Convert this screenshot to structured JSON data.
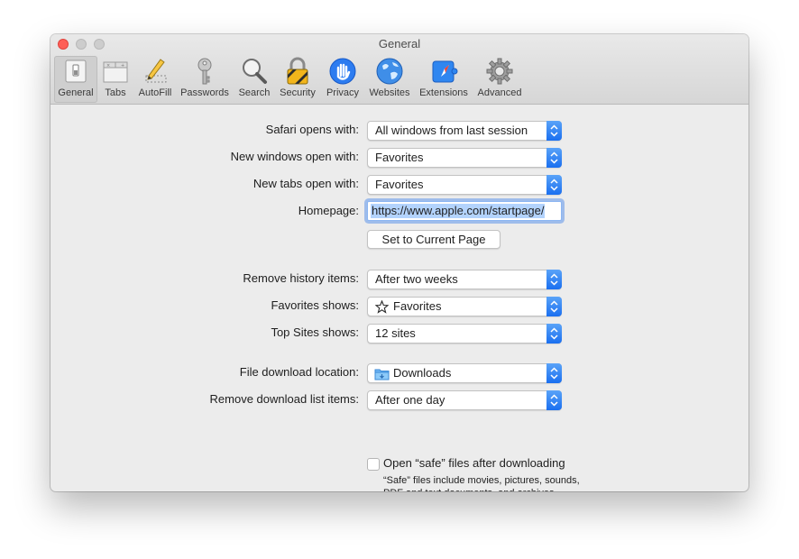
{
  "window": {
    "title": "General"
  },
  "toolbar": {
    "tabs": [
      {
        "label": "General",
        "icon": "general-switch-icon",
        "active": true
      },
      {
        "label": "Tabs",
        "icon": "tabs-icon"
      },
      {
        "label": "AutoFill",
        "icon": "pencil-icon"
      },
      {
        "label": "Passwords",
        "icon": "key-icon"
      },
      {
        "label": "Search",
        "icon": "magnifier-icon"
      },
      {
        "label": "Security",
        "icon": "lock-icon"
      },
      {
        "label": "Privacy",
        "icon": "hand-icon"
      },
      {
        "label": "Websites",
        "icon": "globe-icon"
      },
      {
        "label": "Extensions",
        "icon": "puzzle-compass-icon"
      },
      {
        "label": "Advanced",
        "icon": "gear-icon"
      }
    ]
  },
  "settings": {
    "safari_opens_with": {
      "label": "Safari opens with:",
      "value": "All windows from last session"
    },
    "new_windows_open_with": {
      "label": "New windows open with:",
      "value": "Favorites"
    },
    "new_tabs_open_with": {
      "label": "New tabs open with:",
      "value": "Favorites"
    },
    "homepage": {
      "label": "Homepage:",
      "value": "https://www.apple.com/startpage/"
    },
    "set_current_page": {
      "label": "Set to Current Page"
    },
    "remove_history_items": {
      "label": "Remove history items:",
      "value": "After two weeks"
    },
    "favorites_shows": {
      "label": "Favorites shows:",
      "value": "Favorites",
      "icon": "star-icon"
    },
    "top_sites_shows": {
      "label": "Top Sites shows:",
      "value": "12 sites"
    },
    "file_download_location": {
      "label": "File download location:",
      "value": "Downloads",
      "icon": "folder-icon"
    },
    "remove_download_list_items": {
      "label": "Remove download list items:",
      "value": "After one day"
    },
    "open_safe_files": {
      "label": "Open “safe” files after downloading",
      "checked": false,
      "note": "“Safe” files include movies, pictures, sounds, PDF and text documents, and archives."
    }
  },
  "help": {
    "label": "?"
  },
  "colors": {
    "accent": "#1a6ff0",
    "close": "#fe5f57"
  }
}
